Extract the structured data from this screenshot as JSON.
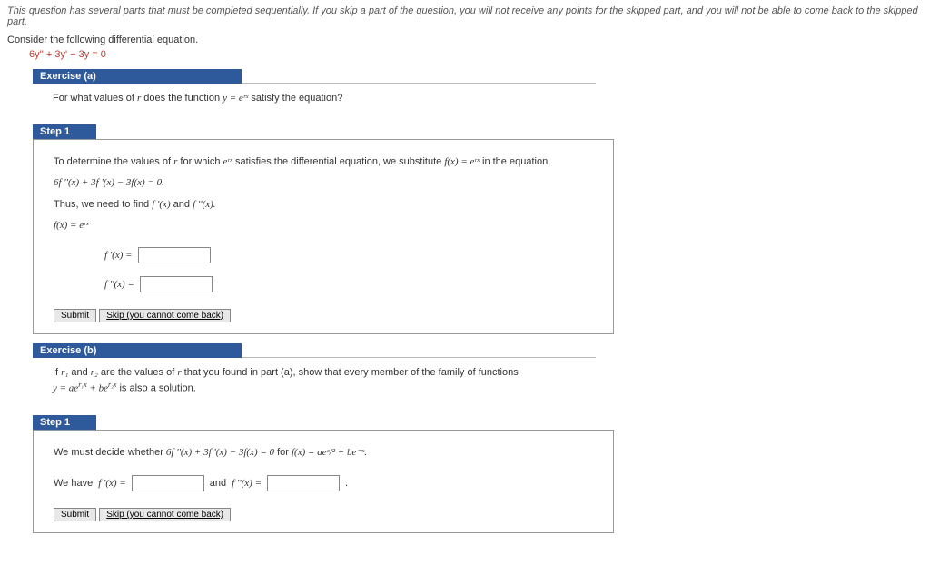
{
  "warning": "This question has several parts that must be completed sequentially. If you skip a part of the question, you will not receive any points for the skipped part, and you will not be able to come back to the skipped part.",
  "prompt": "Consider the following differential equation.",
  "equation": "6y'' + 3y' − 3y = 0",
  "exA": {
    "label": "Exercise (a)",
    "question_pre": "For what values of ",
    "question_var": "r",
    "question_mid": " does the function ",
    "question_fn": "y = eʳˣ",
    "question_post": " satisfy the equation?"
  },
  "stepA": {
    "label": "Step 1",
    "line1a": "To determine the values of ",
    "line1_r": "r",
    "line1b": " for which ",
    "line1_erx": "eʳˣ",
    "line1c": " satisfies the differential equation, we substitute ",
    "line1_fx": "f(x) = eʳˣ",
    "line1d": " in the equation,",
    "eq1": "6f ''(x) + 3f '(x) − 3f(x) = 0.",
    "line2a": "Thus, we need to find ",
    "line2_fp": "f '(x)",
    "line2b": " and ",
    "line2_fpp": "f ''(x).",
    "fx_lhs": "f(x) = ",
    "fx_rhs": "eʳˣ",
    "fpx": "f '(x) = ",
    "fppx": "f ''(x) = "
  },
  "exB": {
    "label": "Exercise (b)",
    "line_a": "If ",
    "r1": "r₁",
    "line_b": " and ",
    "r2": "r₂",
    "line_c": " are the values of ",
    "r": "r",
    "line_d": " that you found in part (a), show that every member of the family of functions",
    "line2_a": "y = ae",
    "line2_sup1": "r₁x",
    "line2_b": " + be",
    "line2_sup2": "r₂x",
    "line2_c": "  is also a solution."
  },
  "stepB": {
    "label": "Step 1",
    "line1a": "We must decide whether ",
    "eq": "6f ''(x) + 3f '(x) − 3f(x) = 0",
    "line1b": " for ",
    "fx": "f(x) = aeˣ/² + be⁻ˣ.",
    "have_a": "We have ",
    "fp": "f '(x) = ",
    "and": " and ",
    "fpp": "f ''(x) = ",
    "period": "."
  },
  "buttons": {
    "submit": "Submit",
    "skip": "Skip (you cannot come back)"
  }
}
